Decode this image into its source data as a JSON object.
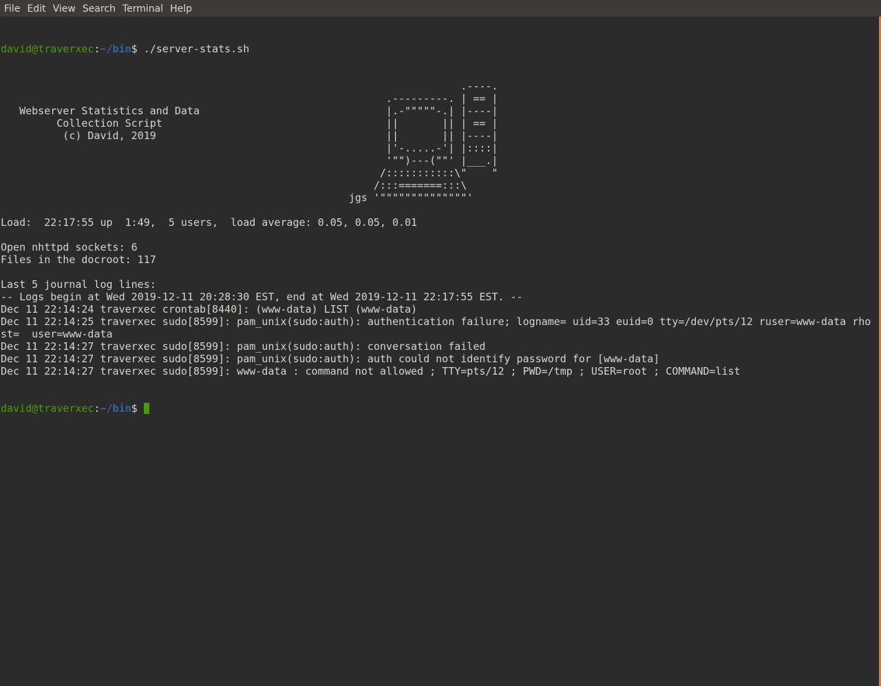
{
  "menubar": {
    "items": [
      "File",
      "Edit",
      "View",
      "Search",
      "Terminal",
      "Help"
    ]
  },
  "prompt": {
    "user_host": "david@traverxec",
    "separator": ":",
    "path": "~/bin",
    "symbol": "$ "
  },
  "command": "./server-stats.sh",
  "output_lines": [
    "                                                                          .----.",
    "                                                              .---------. | == |",
    "   Webserver Statistics and Data                              |.-\"\"\"\"\"-.| |----|",
    "         Collection Script                                    ||       || | == |",
    "          (c) David, 2019                                     ||       || |----|",
    "                                                              |'-.....-'| |::::|",
    "                                                              '\"\")---(\"\"' |___.|",
    "                                                             /:::::::::::\\\"    \"",
    "                                                            /:::=======:::\\",
    "                                                        jgs '\"\"\"\"\"\"\"\"\"\"\"\"\"\"'",
    "",
    "Load:  22:17:55 up  1:49,  5 users,  load average: 0.05, 0.05, 0.01",
    "",
    "Open nhttpd sockets: 6",
    "Files in the docroot: 117",
    "",
    "Last 5 journal log lines:",
    "-- Logs begin at Wed 2019-12-11 20:28:30 EST, end at Wed 2019-12-11 22:17:55 EST. --",
    "Dec 11 22:14:24 traverxec crontab[8440]: (www-data) LIST (www-data)",
    "Dec 11 22:14:25 traverxec sudo[8599]: pam_unix(sudo:auth): authentication failure; logname= uid=33 euid=0 tty=/dev/pts/12 ruser=www-data rho",
    "st=  user=www-data",
    "Dec 11 22:14:27 traverxec sudo[8599]: pam_unix(sudo:auth): conversation failed",
    "Dec 11 22:14:27 traverxec sudo[8599]: pam_unix(sudo:auth): auth could not identify password for [www-data]",
    "Dec 11 22:14:27 traverxec sudo[8599]: www-data : command not allowed ; TTY=pts/12 ; PWD=/tmp ; USER=root ; COMMAND=list"
  ],
  "colors": {
    "background": "#2b2b2b",
    "menubar": "#3c3b37",
    "text": "#d3d7cf",
    "prompt_user": "#4e9a06",
    "prompt_path": "#3465a4",
    "cursor": "#4e9a06",
    "scroll_accent": "#cf7a4c"
  }
}
